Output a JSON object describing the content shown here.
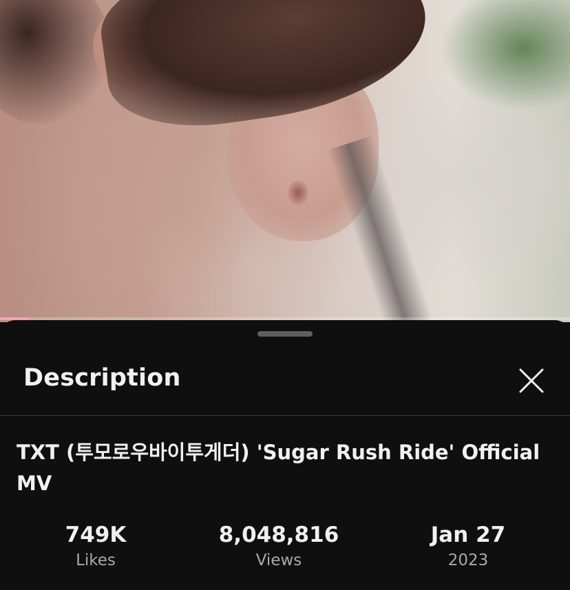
{
  "video": {
    "progress_fraction": 0.05
  },
  "sheet": {
    "title": "Description",
    "close_icon": "close-icon"
  },
  "details": {
    "video_title": "TXT (투모로우바이투게더) 'Sugar Rush Ride' Official MV",
    "stats": {
      "likes_value": "749K",
      "likes_label": "Likes",
      "views_value": "8,048,816",
      "views_label": "Views",
      "date_value": "Jan 27",
      "date_label": "2023"
    }
  },
  "colors": {
    "background": "#0f0f0f",
    "progress_fill": "#f4a6b2",
    "text_primary": "#f1f1f1",
    "text_secondary": "#aaaaaa"
  }
}
